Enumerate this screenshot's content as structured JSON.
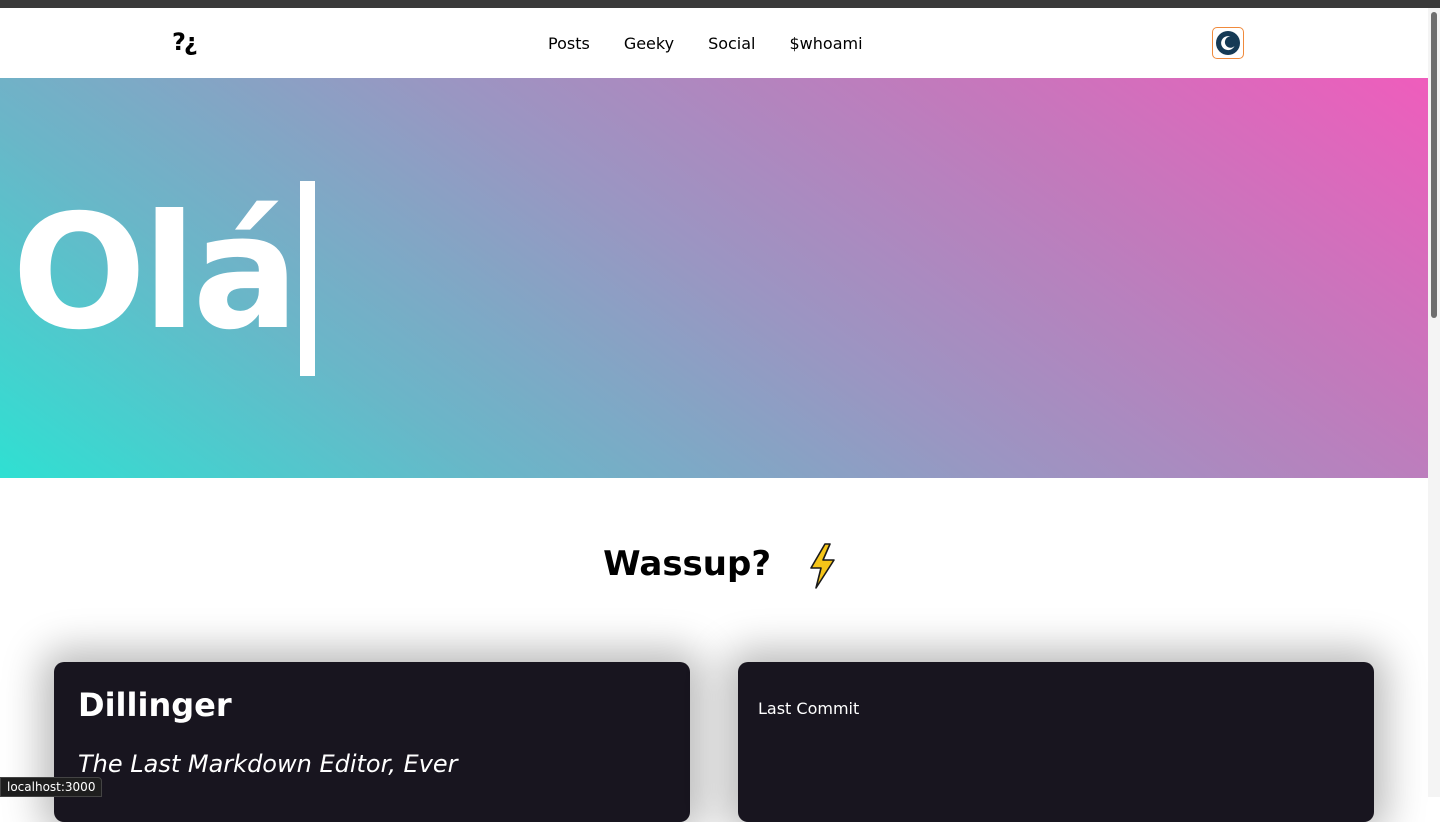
{
  "nav": {
    "logo": "?¿",
    "links": [
      {
        "label": "Posts"
      },
      {
        "label": "Geeky"
      },
      {
        "label": "Social"
      },
      {
        "label": "$whoami"
      }
    ],
    "theme_toggle_icon": "moon-icon"
  },
  "hero": {
    "text": "Olá",
    "gradient_start": "#2fe0d2",
    "gradient_end": "#f05cbc"
  },
  "section": {
    "title": "Wassup?",
    "icon": "lightning-icon"
  },
  "cards": {
    "project": {
      "title": "Dillinger",
      "subtitle": "The Last Markdown Editor, Ever"
    },
    "commit": {
      "label": "Last Commit"
    }
  },
  "status_bar": {
    "url": "localhost:3000"
  },
  "colors": {
    "card_bg": "#18151f",
    "toggle_border": "#f08a3c",
    "bolt_fill": "#f5c518"
  }
}
